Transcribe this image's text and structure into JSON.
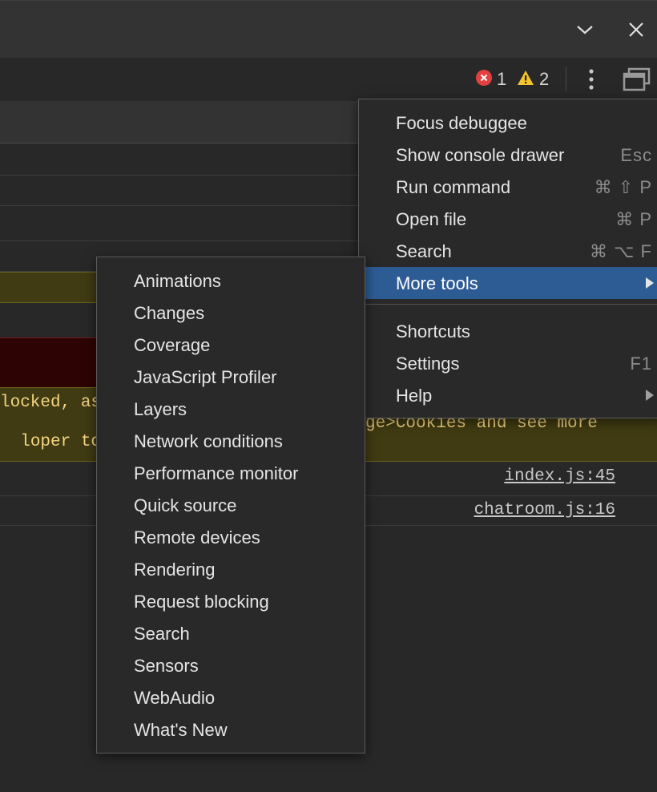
{
  "toolbar": {
    "error_count": "1",
    "warning_count": "2",
    "colors": {
      "error": "#e3413f",
      "warning": "#f4c430"
    }
  },
  "console": {
    "warning_line1": "locked, as",
    "warning_line2_left": "loper tool",
    "warning_line2_right": "ge>Cookies and see more",
    "sources": [
      "index.js:45",
      "chatroom.js:16"
    ]
  },
  "main_menu": {
    "items": [
      {
        "label": "Focus debuggee",
        "shortcut": ""
      },
      {
        "label": "Show console drawer",
        "shortcut": "Esc"
      },
      {
        "label": "Run command",
        "shortcut": "⌘ ⇧ P"
      },
      {
        "label": "Open file",
        "shortcut": "⌘ P"
      },
      {
        "label": "Search",
        "shortcut": "⌘ ⌥ F"
      },
      {
        "label": "More tools",
        "shortcut": ""
      },
      {
        "label": "Shortcuts",
        "shortcut": ""
      },
      {
        "label": "Settings",
        "shortcut": "F1"
      },
      {
        "label": "Help",
        "shortcut": ""
      }
    ],
    "active_color": "#2d5c95"
  },
  "submenu": {
    "items": [
      "Animations",
      "Changes",
      "Coverage",
      "JavaScript Profiler",
      "Layers",
      "Network conditions",
      "Performance monitor",
      "Quick source",
      "Remote devices",
      "Rendering",
      "Request blocking",
      "Search",
      "Sensors",
      "WebAudio",
      "What's New"
    ]
  }
}
